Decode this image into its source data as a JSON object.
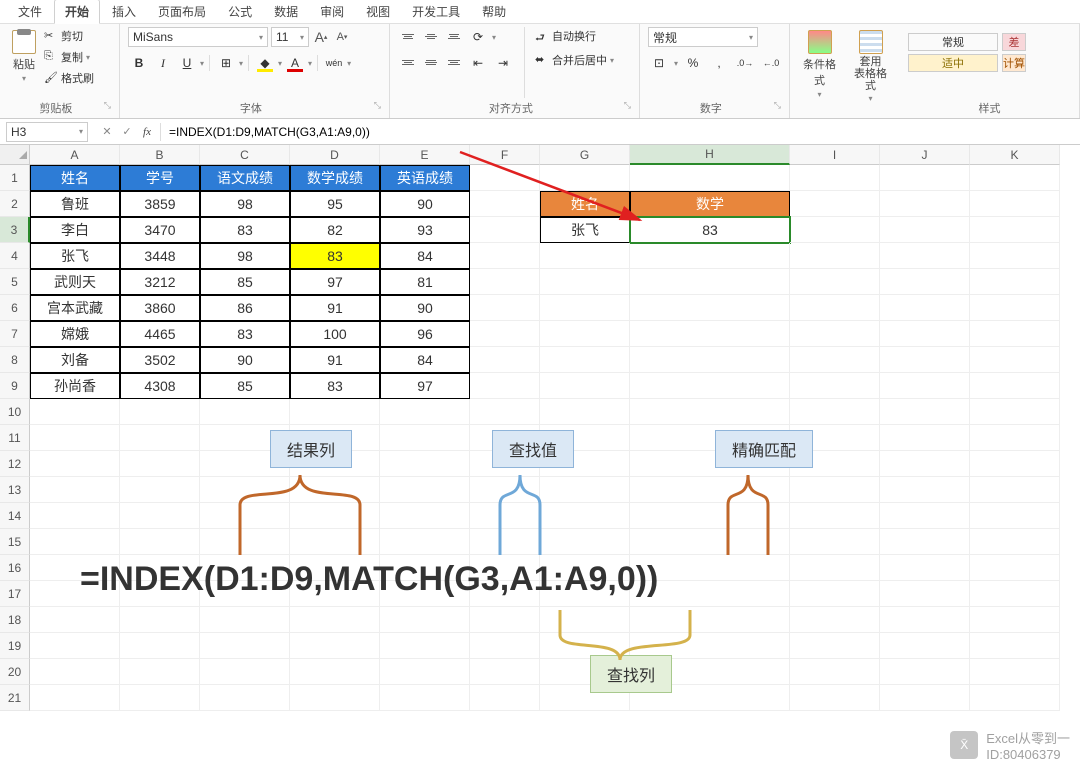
{
  "menu": {
    "items": [
      "文件",
      "开始",
      "插入",
      "页面布局",
      "公式",
      "数据",
      "审阅",
      "视图",
      "开发工具",
      "帮助"
    ],
    "active": 1
  },
  "ribbon": {
    "clipboard": {
      "title": "剪贴板",
      "paste": "粘贴",
      "cut": "剪切",
      "copy": "复制",
      "painter": "格式刷"
    },
    "font": {
      "title": "字体",
      "name": "MiSans",
      "size": "11",
      "aplus": "A",
      "aminus": "A",
      "bold": "B",
      "italic": "I",
      "underline": "U",
      "wen": "wén"
    },
    "align": {
      "title": "对齐方式",
      "wrap": "自动换行",
      "merge": "合并后居中"
    },
    "number": {
      "title": "数字",
      "format": "常规",
      "percent": "%"
    },
    "styles_btn": {
      "title": "样式",
      "cond": "条件格式",
      "table": "套用\n表格格式"
    },
    "cell_styles": {
      "normal": "常规",
      "bad": "差",
      "good": "适中",
      "calc": "计算"
    }
  },
  "namebox": "H3",
  "formula": "=INDEX(D1:D9,MATCH(G3,A1:A9,0))",
  "columns": [
    "A",
    "B",
    "C",
    "D",
    "E",
    "F",
    "G",
    "H",
    "I",
    "J",
    "K"
  ],
  "rows_shown": 21,
  "table": {
    "header": [
      "姓名",
      "学号",
      "语文成绩",
      "数学成绩",
      "英语成绩"
    ],
    "rows": [
      [
        "鲁班",
        "3859",
        "98",
        "95",
        "90"
      ],
      [
        "李白",
        "3470",
        "83",
        "82",
        "93"
      ],
      [
        "张飞",
        "3448",
        "98",
        "83",
        "84"
      ],
      [
        "武则天",
        "3212",
        "85",
        "97",
        "81"
      ],
      [
        "宫本武藏",
        "3860",
        "86",
        "91",
        "90"
      ],
      [
        "嫦娥",
        "4465",
        "83",
        "100",
        "96"
      ],
      [
        "刘备",
        "3502",
        "90",
        "91",
        "84"
      ],
      [
        "孙尚香",
        "4308",
        "85",
        "83",
        "97"
      ]
    ],
    "highlight": {
      "row": 3,
      "col": 3
    }
  },
  "lookup": {
    "hdr": [
      "姓名",
      "数学"
    ],
    "row": [
      "张飞",
      "83"
    ]
  },
  "annotation": {
    "result_col": "结果列",
    "lookup_val": "查找值",
    "exact": "精确匹配",
    "lookup_col": "查找列",
    "formula": "=INDEX(D1:D9,MATCH(G3,A1:A9,0))"
  },
  "watermark": {
    "line1": "Excel从零到一",
    "line2": "ID:80406379"
  }
}
